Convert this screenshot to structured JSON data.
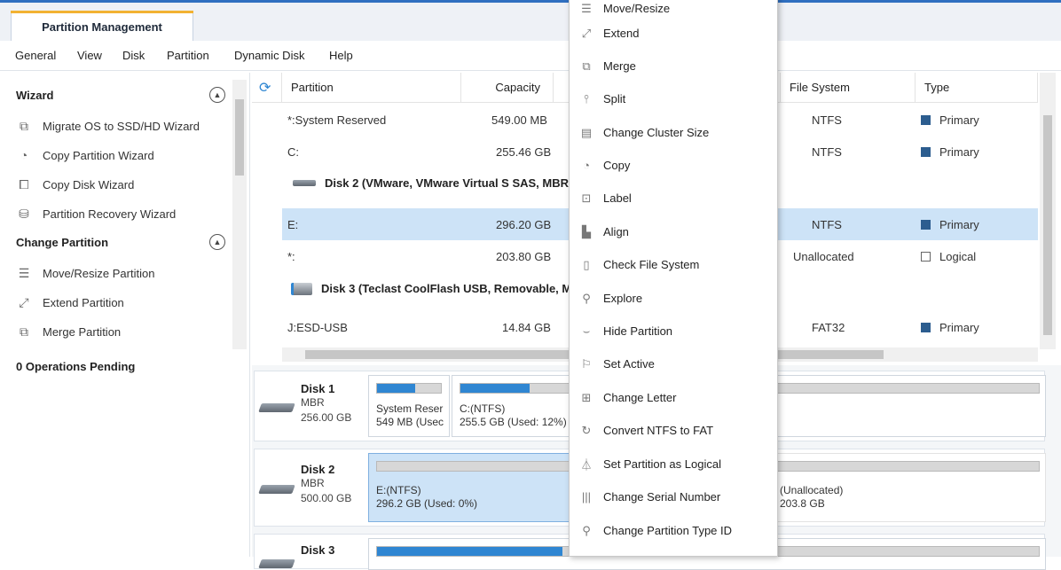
{
  "app": {
    "tab_title": "Partition Management"
  },
  "menu": [
    "General",
    "View",
    "Disk",
    "Partition",
    "Dynamic Disk",
    "Help"
  ],
  "sidebar": {
    "wizard_title": "Wizard",
    "wizard_items": [
      {
        "label": "Migrate OS to SSD/HD Wizard",
        "icon": "migrate-icon"
      },
      {
        "label": "Copy Partition Wizard",
        "icon": "copy-partition-icon"
      },
      {
        "label": "Copy Disk Wizard",
        "icon": "copy-disk-icon"
      },
      {
        "label": "Partition Recovery Wizard",
        "icon": "recovery-icon"
      }
    ],
    "change_title": "Change Partition",
    "change_items": [
      {
        "label": "Move/Resize Partition",
        "icon": "move-resize-icon"
      },
      {
        "label": "Extend Partition",
        "icon": "extend-icon"
      },
      {
        "label": "Merge Partition",
        "icon": "merge-icon"
      }
    ],
    "pending": "0 Operations Pending"
  },
  "table": {
    "headers": {
      "partition": "Partition",
      "capacity": "Capacity",
      "filesystem": "File System",
      "type": "Type"
    },
    "rows": [
      {
        "partition": "*:System Reserved",
        "capacity": "549.00 MB",
        "fs": "NTFS",
        "type": "Primary"
      },
      {
        "partition": "C:",
        "capacity": "255.46 GB",
        "fs": "NTFS",
        "type": "Primary"
      },
      {
        "partition": "E:",
        "capacity": "296.20 GB",
        "fs": "NTFS",
        "type": "Primary"
      },
      {
        "partition": "*:",
        "capacity": "203.80 GB",
        "fs": "Unallocated",
        "type": "Logical"
      },
      {
        "partition": "J:ESD-USB",
        "capacity": "14.84 GB",
        "fs": "FAT32",
        "type": "Primary"
      }
    ],
    "disk2_label": "Disk 2 (VMware, VMware Virtual S SAS, MBR,",
    "disk3_label": "Disk 3 (Teclast CoolFlash USB, Removable, M"
  },
  "diskmap": {
    "disk1": {
      "name": "Disk 1",
      "scheme": "MBR",
      "size": "256.00 GB",
      "p1_line1": "System Reser",
      "p1_line2": "549 MB (Usec",
      "p1_used": 0.6,
      "p2_line1": "C:(NTFS)",
      "p2_line2": "255.5 GB (Used: 12%)",
      "p2_used": 0.12
    },
    "disk2": {
      "name": "Disk 2",
      "scheme": "MBR",
      "size": "500.00 GB",
      "p1_line1": "E:(NTFS)",
      "p1_line2": "296.2 GB (Used: 0%)",
      "p1_used": 0.0,
      "p2_line1": "(Unallocated)",
      "p2_line2": "203.8 GB"
    },
    "disk3": {
      "name": "Disk 3"
    }
  },
  "context_menu": [
    {
      "label": "Move/Resize",
      "icon": "move-resize-icon"
    },
    {
      "label": "Extend",
      "icon": "extend-icon"
    },
    {
      "label": "Merge",
      "icon": "merge-icon"
    },
    {
      "label": "Split",
      "icon": "split-icon"
    },
    {
      "label": "Change Cluster Size",
      "icon": "cluster-icon"
    },
    {
      "label": "Copy",
      "icon": "copy-icon"
    },
    {
      "label": "Label",
      "icon": "label-icon"
    },
    {
      "label": "Align",
      "icon": "align-icon"
    },
    {
      "label": "Check File System",
      "icon": "check-fs-icon"
    },
    {
      "label": "Explore",
      "icon": "explore-icon"
    },
    {
      "label": "Hide Partition",
      "icon": "hide-icon"
    },
    {
      "label": "Set Active",
      "icon": "set-active-icon"
    },
    {
      "label": "Change Letter",
      "icon": "letter-icon"
    },
    {
      "label": "Convert NTFS to FAT",
      "icon": "convert-icon"
    },
    {
      "label": "Set Partition as Logical",
      "icon": "logical-icon"
    },
    {
      "label": "Change Serial Number",
      "icon": "serial-icon"
    },
    {
      "label": "Change Partition Type ID",
      "icon": "type-id-icon"
    }
  ],
  "colors": {
    "accent": "#2f86d2",
    "primary_square": "#2c5d8f",
    "selection": "#cde3f7",
    "tab_highlight": "#f2b233"
  }
}
